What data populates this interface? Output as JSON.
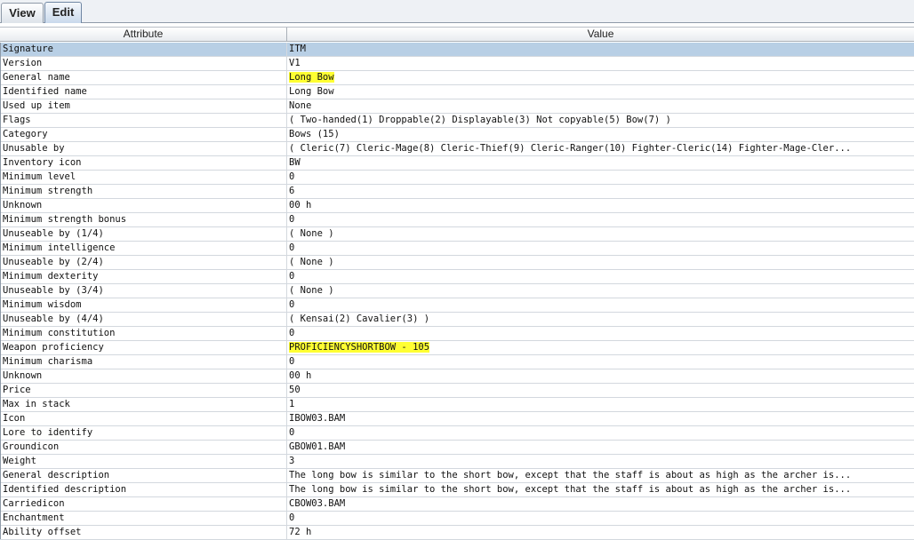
{
  "tabs": [
    {
      "label": "View"
    },
    {
      "label": "Edit"
    }
  ],
  "columns": {
    "attribute": "Attribute",
    "value": "Value"
  },
  "highlight_color": "#ffff33",
  "selection_color": "#b8cfe5",
  "rows": [
    {
      "attribute": "Signature",
      "value": "ITM"
    },
    {
      "attribute": "Version",
      "value": "V1"
    },
    {
      "attribute": "General name",
      "value": "Long Bow"
    },
    {
      "attribute": "Identified name",
      "value": "Long Bow"
    },
    {
      "attribute": "Used up item",
      "value": "None"
    },
    {
      "attribute": "Flags",
      "value": "( Two-handed(1) Droppable(2) Displayable(3) Not copyable(5) Bow(7) )"
    },
    {
      "attribute": "Category",
      "value": "Bows (15)"
    },
    {
      "attribute": "Unusable by",
      "value": "( Cleric(7) Cleric-Mage(8) Cleric-Thief(9) Cleric-Ranger(10) Fighter-Cleric(14) Fighter-Mage-Cler..."
    },
    {
      "attribute": "Inventory icon",
      "value": "BW"
    },
    {
      "attribute": "Minimum level",
      "value": "0"
    },
    {
      "attribute": "Minimum strength",
      "value": "6"
    },
    {
      "attribute": "Unknown",
      "value": "00 h"
    },
    {
      "attribute": "Minimum strength bonus",
      "value": "0"
    },
    {
      "attribute": "Unuseable by (1/4)",
      "value": "( None )"
    },
    {
      "attribute": "Minimum intelligence",
      "value": "0"
    },
    {
      "attribute": "Unuseable by (2/4)",
      "value": "( None )"
    },
    {
      "attribute": "Minimum dexterity",
      "value": "0"
    },
    {
      "attribute": "Unuseable by (3/4)",
      "value": "( None )"
    },
    {
      "attribute": "Minimum wisdom",
      "value": "0"
    },
    {
      "attribute": "Unuseable by (4/4)",
      "value": "( Kensai(2) Cavalier(3) )"
    },
    {
      "attribute": "Minimum constitution",
      "value": "0"
    },
    {
      "attribute": "Weapon proficiency",
      "value": "PROFICIENCYSHORTBOW - 105"
    },
    {
      "attribute": "Minimum charisma",
      "value": "0"
    },
    {
      "attribute": "Unknown",
      "value": "00 h"
    },
    {
      "attribute": "Price",
      "value": "50"
    },
    {
      "attribute": "Max in stack",
      "value": "1"
    },
    {
      "attribute": "Icon",
      "value": "IBOW03.BAM"
    },
    {
      "attribute": "Lore to identify",
      "value": "0"
    },
    {
      "attribute": "Groundicon",
      "value": "GBOW01.BAM"
    },
    {
      "attribute": "Weight",
      "value": "3"
    },
    {
      "attribute": "General description",
      "value": "The long bow is similar to the short bow, except that the staff is about as high as the archer is..."
    },
    {
      "attribute": "Identified description",
      "value": "The long bow is similar to the short bow, except that the staff is about as high as the archer is..."
    },
    {
      "attribute": "Carriedicon",
      "value": "CBOW03.BAM"
    },
    {
      "attribute": "Enchantment",
      "value": "0"
    },
    {
      "attribute": "Ability offset",
      "value": "72 h"
    }
  ]
}
